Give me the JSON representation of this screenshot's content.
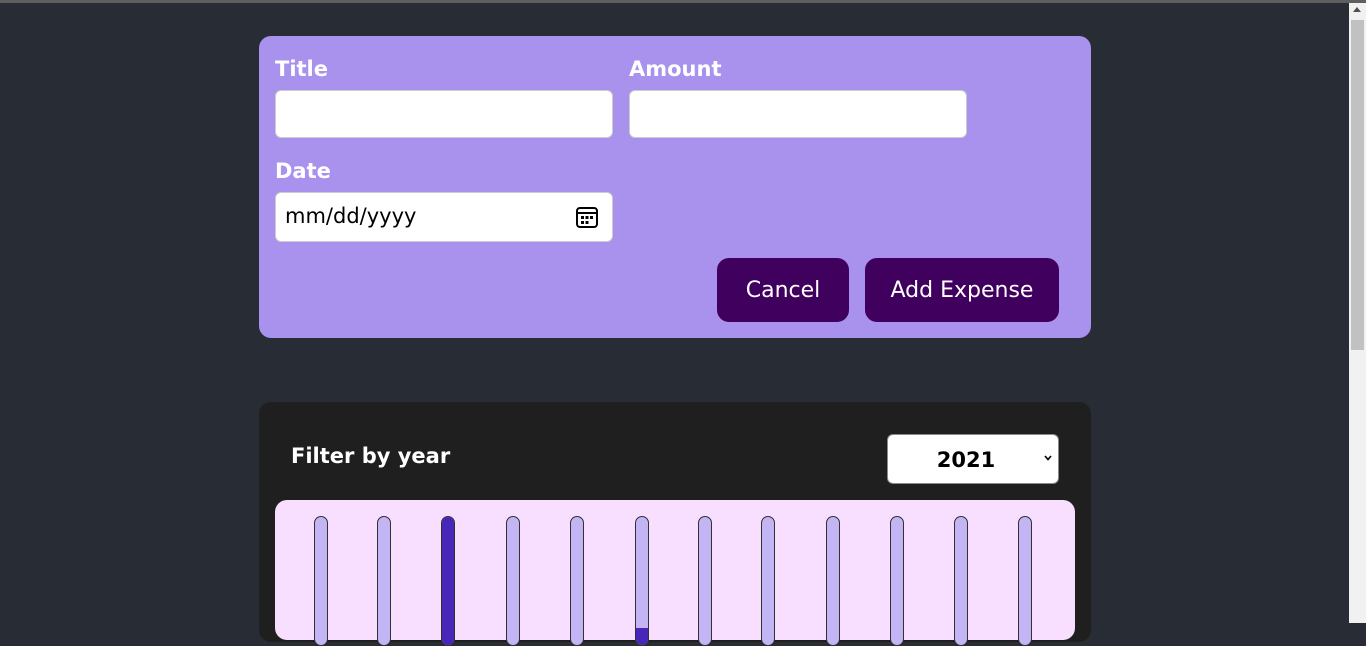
{
  "form": {
    "title_label": "Title",
    "amount_label": "Amount",
    "date_label": "Date",
    "title_value": "",
    "amount_value": "",
    "date_placeholder": "mm/dd/yyyy",
    "cancel_label": "Cancel",
    "add_label": "Add Expense",
    "card_color": "#a892ee",
    "button_color": "#40005d"
  },
  "expenses": {
    "filter_label": "Filter by year",
    "selected_year": "2021",
    "chart_bg": "#f8dfff",
    "bar_color": "#c3b4f3",
    "fill_color": "#4826b9"
  },
  "chart_data": {
    "type": "bar",
    "categories": [
      "",
      "",
      "",
      "",
      "",
      "",
      "",
      "",
      "",
      "",
      "",
      ""
    ],
    "values": [
      0,
      0,
      1,
      0,
      0,
      0.13,
      0,
      0,
      0,
      0,
      0,
      0
    ],
    "ylim": [
      0,
      1
    ],
    "note_scale": "fill fraction of each bar"
  }
}
